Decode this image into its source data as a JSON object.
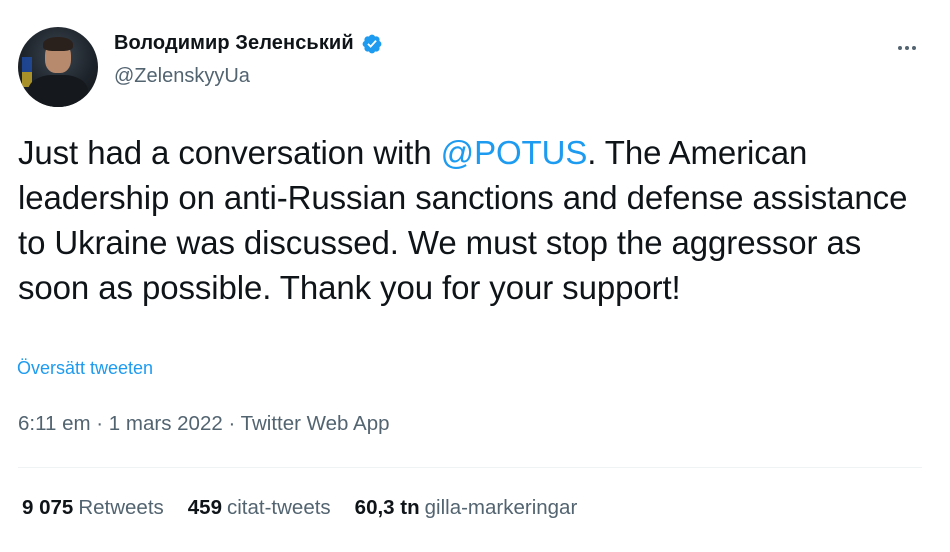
{
  "author": {
    "display_name": "Володимир Зеленський",
    "handle": "@ZelenskyyUa",
    "verified": true
  },
  "tweet": {
    "text_before_mention": "Just had a conversation with ",
    "mention": "@POTUS",
    "text_after_mention": ". The American leadership on anti-Russian sanctions and defense assistance to Ukraine was discussed. We must stop the aggressor as soon as possible. Thank you for your support!",
    "translate_label": "Översätt tweeten",
    "time": "6:11 em",
    "date": "1 mars 2022",
    "source": "Twitter Web App",
    "separator": "·"
  },
  "stats": {
    "retweets_count": "9 075",
    "retweets_label": "Retweets",
    "quotes_count": "459",
    "quotes_label": "citat-tweets",
    "likes_count": "60,3 tn",
    "likes_label": "gilla-markeringar"
  },
  "icons": {
    "verified": "verified-badge-icon",
    "more": "more-options-icon"
  },
  "colors": {
    "accent": "#1d9bf0",
    "text": "#0f1419",
    "secondary": "#536471",
    "divider": "#eff3f4"
  }
}
